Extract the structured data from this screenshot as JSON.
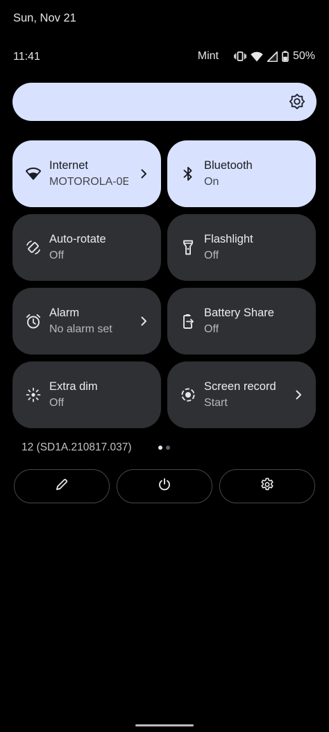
{
  "status_bar": {
    "date": "Sun, Nov 21",
    "time": "11:41",
    "carrier": "Mint",
    "battery": "50%",
    "icons": [
      "vibrate-icon",
      "wifi-icon",
      "signal-icon",
      "battery-icon"
    ]
  },
  "brightness": {
    "icon": "brightness-icon",
    "color": "#d8e2ff"
  },
  "tiles": [
    {
      "title": "Internet",
      "subtitle": "MOTOROLA-0E",
      "icon": "wifi-icon",
      "active": true,
      "chevron": true
    },
    {
      "title": "Bluetooth",
      "subtitle": "On",
      "icon": "bluetooth-icon",
      "active": true,
      "chevron": false
    },
    {
      "title": "Auto-rotate",
      "subtitle": "Off",
      "icon": "auto-rotate-icon",
      "active": false,
      "chevron": false
    },
    {
      "title": "Flashlight",
      "subtitle": "Off",
      "icon": "flashlight-icon",
      "active": false,
      "chevron": false
    },
    {
      "title": "Alarm",
      "subtitle": "No alarm set",
      "icon": "alarm-icon",
      "active": false,
      "chevron": true
    },
    {
      "title": "Battery Share",
      "subtitle": "Off",
      "icon": "battery-share-icon",
      "active": false,
      "chevron": false
    },
    {
      "title": "Extra dim",
      "subtitle": "Off",
      "icon": "extra-dim-icon",
      "active": false,
      "chevron": false
    },
    {
      "title": "Screen record",
      "subtitle": "Start",
      "icon": "screen-record-icon",
      "active": false,
      "chevron": true
    }
  ],
  "footer": {
    "build": "12 (SD1A.210817.037)",
    "page_count": 2,
    "current_page": 1,
    "buttons": [
      "edit-icon",
      "power-icon",
      "settings-icon"
    ]
  },
  "colors": {
    "background": "#000000",
    "tile_active": "#d8e2ff",
    "tile_inactive": "#2f3033"
  }
}
